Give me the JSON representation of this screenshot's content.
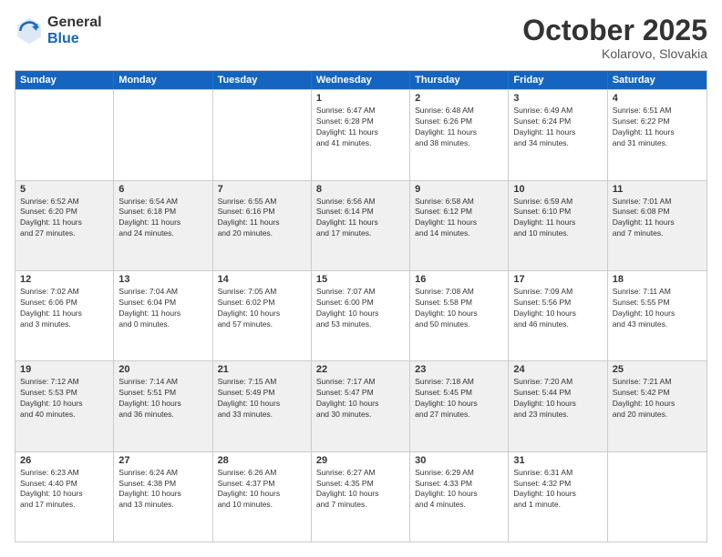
{
  "header": {
    "logo_general": "General",
    "logo_blue": "Blue",
    "month_title": "October 2025",
    "location": "Kolarovo, Slovakia"
  },
  "calendar": {
    "days_of_week": [
      "Sunday",
      "Monday",
      "Tuesday",
      "Wednesday",
      "Thursday",
      "Friday",
      "Saturday"
    ],
    "weeks": [
      [
        {
          "day": "",
          "info": ""
        },
        {
          "day": "",
          "info": ""
        },
        {
          "day": "",
          "info": ""
        },
        {
          "day": "1",
          "info": "Sunrise: 6:47 AM\nSunset: 6:28 PM\nDaylight: 11 hours\nand 41 minutes."
        },
        {
          "day": "2",
          "info": "Sunrise: 6:48 AM\nSunset: 6:26 PM\nDaylight: 11 hours\nand 38 minutes."
        },
        {
          "day": "3",
          "info": "Sunrise: 6:49 AM\nSunset: 6:24 PM\nDaylight: 11 hours\nand 34 minutes."
        },
        {
          "day": "4",
          "info": "Sunrise: 6:51 AM\nSunset: 6:22 PM\nDaylight: 11 hours\nand 31 minutes."
        }
      ],
      [
        {
          "day": "5",
          "info": "Sunrise: 6:52 AM\nSunset: 6:20 PM\nDaylight: 11 hours\nand 27 minutes."
        },
        {
          "day": "6",
          "info": "Sunrise: 6:54 AM\nSunset: 6:18 PM\nDaylight: 11 hours\nand 24 minutes."
        },
        {
          "day": "7",
          "info": "Sunrise: 6:55 AM\nSunset: 6:16 PM\nDaylight: 11 hours\nand 20 minutes."
        },
        {
          "day": "8",
          "info": "Sunrise: 6:56 AM\nSunset: 6:14 PM\nDaylight: 11 hours\nand 17 minutes."
        },
        {
          "day": "9",
          "info": "Sunrise: 6:58 AM\nSunset: 6:12 PM\nDaylight: 11 hours\nand 14 minutes."
        },
        {
          "day": "10",
          "info": "Sunrise: 6:59 AM\nSunset: 6:10 PM\nDaylight: 11 hours\nand 10 minutes."
        },
        {
          "day": "11",
          "info": "Sunrise: 7:01 AM\nSunset: 6:08 PM\nDaylight: 11 hours\nand 7 minutes."
        }
      ],
      [
        {
          "day": "12",
          "info": "Sunrise: 7:02 AM\nSunset: 6:06 PM\nDaylight: 11 hours\nand 3 minutes."
        },
        {
          "day": "13",
          "info": "Sunrise: 7:04 AM\nSunset: 6:04 PM\nDaylight: 11 hours\nand 0 minutes."
        },
        {
          "day": "14",
          "info": "Sunrise: 7:05 AM\nSunset: 6:02 PM\nDaylight: 10 hours\nand 57 minutes."
        },
        {
          "day": "15",
          "info": "Sunrise: 7:07 AM\nSunset: 6:00 PM\nDaylight: 10 hours\nand 53 minutes."
        },
        {
          "day": "16",
          "info": "Sunrise: 7:08 AM\nSunset: 5:58 PM\nDaylight: 10 hours\nand 50 minutes."
        },
        {
          "day": "17",
          "info": "Sunrise: 7:09 AM\nSunset: 5:56 PM\nDaylight: 10 hours\nand 46 minutes."
        },
        {
          "day": "18",
          "info": "Sunrise: 7:11 AM\nSunset: 5:55 PM\nDaylight: 10 hours\nand 43 minutes."
        }
      ],
      [
        {
          "day": "19",
          "info": "Sunrise: 7:12 AM\nSunset: 5:53 PM\nDaylight: 10 hours\nand 40 minutes."
        },
        {
          "day": "20",
          "info": "Sunrise: 7:14 AM\nSunset: 5:51 PM\nDaylight: 10 hours\nand 36 minutes."
        },
        {
          "day": "21",
          "info": "Sunrise: 7:15 AM\nSunset: 5:49 PM\nDaylight: 10 hours\nand 33 minutes."
        },
        {
          "day": "22",
          "info": "Sunrise: 7:17 AM\nSunset: 5:47 PM\nDaylight: 10 hours\nand 30 minutes."
        },
        {
          "day": "23",
          "info": "Sunrise: 7:18 AM\nSunset: 5:45 PM\nDaylight: 10 hours\nand 27 minutes."
        },
        {
          "day": "24",
          "info": "Sunrise: 7:20 AM\nSunset: 5:44 PM\nDaylight: 10 hours\nand 23 minutes."
        },
        {
          "day": "25",
          "info": "Sunrise: 7:21 AM\nSunset: 5:42 PM\nDaylight: 10 hours\nand 20 minutes."
        }
      ],
      [
        {
          "day": "26",
          "info": "Sunrise: 6:23 AM\nSunset: 4:40 PM\nDaylight: 10 hours\nand 17 minutes."
        },
        {
          "day": "27",
          "info": "Sunrise: 6:24 AM\nSunset: 4:38 PM\nDaylight: 10 hours\nand 13 minutes."
        },
        {
          "day": "28",
          "info": "Sunrise: 6:26 AM\nSunset: 4:37 PM\nDaylight: 10 hours\nand 10 minutes."
        },
        {
          "day": "29",
          "info": "Sunrise: 6:27 AM\nSunset: 4:35 PM\nDaylight: 10 hours\nand 7 minutes."
        },
        {
          "day": "30",
          "info": "Sunrise: 6:29 AM\nSunset: 4:33 PM\nDaylight: 10 hours\nand 4 minutes."
        },
        {
          "day": "31",
          "info": "Sunrise: 6:31 AM\nSunset: 4:32 PM\nDaylight: 10 hours\nand 1 minute."
        },
        {
          "day": "",
          "info": ""
        }
      ]
    ]
  }
}
